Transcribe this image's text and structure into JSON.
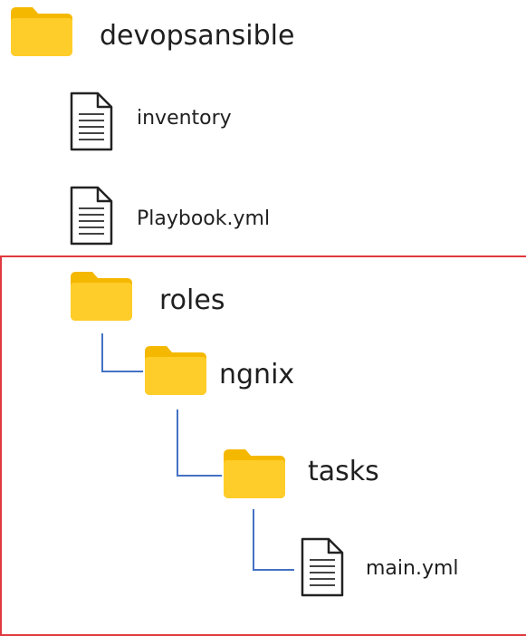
{
  "tree": {
    "root_folder": {
      "label": "devopsansible",
      "icon": "folder-icon"
    },
    "inventory_file": {
      "label": "inventory",
      "icon": "document-icon"
    },
    "playbook_file": {
      "label": "Playbook.yml",
      "icon": "document-icon"
    },
    "roles_folder": {
      "label": "roles",
      "icon": "folder-icon"
    },
    "ngnix_folder": {
      "label": "ngnix",
      "icon": "folder-icon"
    },
    "tasks_folder": {
      "label": "tasks",
      "icon": "folder-icon"
    },
    "main_file": {
      "label": "main.yml",
      "icon": "document-icon"
    }
  },
  "colors": {
    "folder_back": "#f5b800",
    "folder_front": "#ffcd29",
    "highlight_border": "#e0393e",
    "connector_line": "#4472c4"
  }
}
